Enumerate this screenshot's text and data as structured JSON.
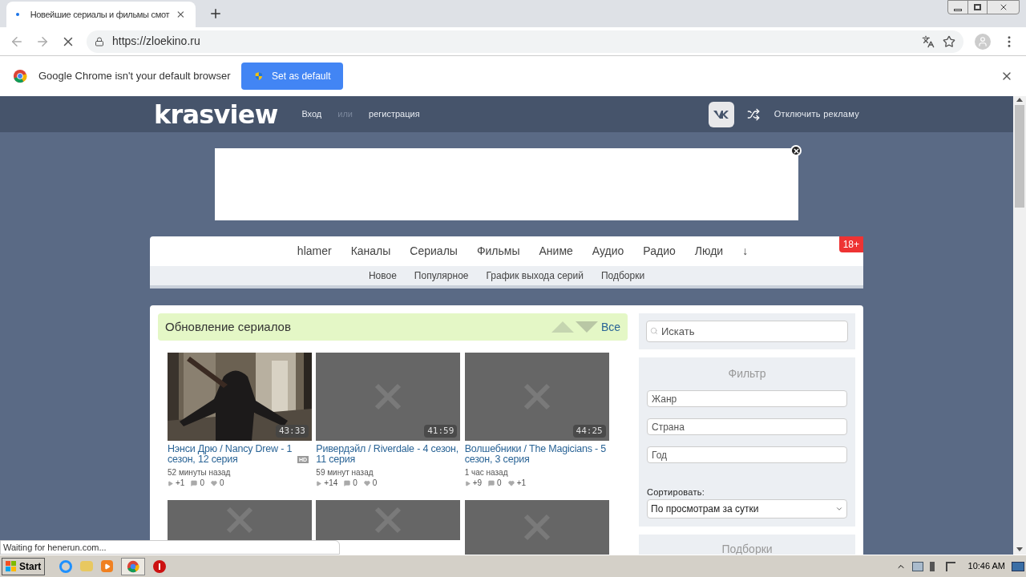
{
  "browser": {
    "tab_title": "Новейшие сериалы и фильмы смот",
    "url": "https://zloekino.ru",
    "infobar_text": "Google Chrome isn't your default browser",
    "infobar_button": "Set as default"
  },
  "header": {
    "logo": "krasview",
    "login": "Вход",
    "or": "или",
    "register": "регистрация",
    "ads_off": "Отключить рекламу"
  },
  "nav": {
    "items": [
      "hlamer",
      "Каналы",
      "Сериалы",
      "Фильмы",
      "Аниме",
      "Аудио",
      "Радио",
      "Люди",
      "↓"
    ],
    "badge": "18+",
    "sub_items": [
      "Новое",
      "Популярное",
      "График выхода серий",
      "Подборки"
    ]
  },
  "section": {
    "title": "Обновление сериалов",
    "all_link": "Все"
  },
  "cards": [
    {
      "kind": "picture",
      "duration": "43:33",
      "title": "Нэнси Дрю / Nancy Drew - 1 сезон, 12 серия",
      "badge": "HD",
      "time": "52 минуты назад",
      "views": "+1",
      "comments": "0",
      "likes": "0"
    },
    {
      "kind": "placeholder",
      "duration": "41:59",
      "title": "Ривердэйл / Riverdale - 4 сезон, 11 серия",
      "time": "59 минут назад",
      "views": "+14",
      "comments": "0",
      "likes": "0"
    },
    {
      "kind": "placeholder",
      "duration": "44:25",
      "title": "Волшебники / The Magicians - 5 сезон, 3 серия",
      "time": "1 час назад",
      "views": "+9",
      "comments": "0",
      "likes": "+1"
    },
    {
      "kind": "placeholder"
    },
    {
      "kind": "placeholder"
    },
    {
      "kind": "placeholder"
    }
  ],
  "sidebar": {
    "search_placeholder": "Искать",
    "filter_title": "Фильтр",
    "filter_placeholders": [
      "Жанр",
      "Страна",
      "Год"
    ],
    "sort_label": "Сортировать:",
    "sort_value": "По просмотрам за сутки",
    "collections_title": "Подборки"
  },
  "status_bar": "Waiting for henerun.com...",
  "taskbar": {
    "start": "Start",
    "time": "10:46 AM"
  }
}
